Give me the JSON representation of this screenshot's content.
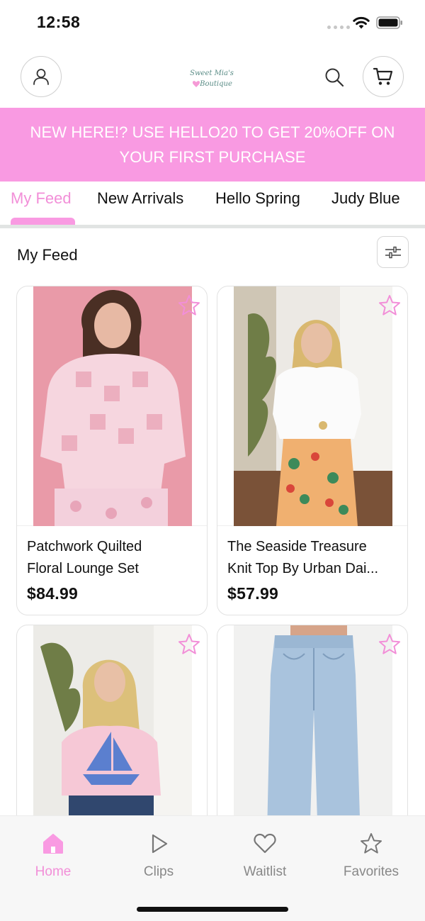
{
  "status_bar": {
    "time": "12:58"
  },
  "header": {
    "logo_line1": "Sweet Mia's",
    "logo_line2": "Boutique"
  },
  "promo": {
    "text": "NEW HERE!? USE HELLO20 TO GET 20%OFF ON YOUR FIRST PURCHASE"
  },
  "tabs": [
    {
      "label": "My Feed",
      "active": true
    },
    {
      "label": "New Arrivals"
    },
    {
      "label": "Hello Spring"
    },
    {
      "label": "Judy Blue"
    }
  ],
  "section": {
    "title": "My Feed"
  },
  "products": [
    {
      "name_line1": "Patchwork Quilted",
      "name_line2": "Floral Lounge Set",
      "price": "$84.99"
    },
    {
      "name_line1": "The Seaside Treasure",
      "name_line2": "Knit Top By Urban Dai...",
      "price": "$57.99"
    },
    {
      "name_line1": "",
      "name_line2": "",
      "price": ""
    },
    {
      "name_line1": "",
      "name_line2": "",
      "price": ""
    }
  ],
  "bottom_nav": [
    {
      "label": "Home",
      "icon": "home-icon",
      "active": true
    },
    {
      "label": "Clips",
      "icon": "play-icon"
    },
    {
      "label": "Waitlist",
      "icon": "heart-icon"
    },
    {
      "label": "Favorites",
      "icon": "star-icon"
    }
  ],
  "colors": {
    "accent": "#f99ae2",
    "accent_text": "#f28fd8",
    "divider": "#e1e4e3"
  }
}
